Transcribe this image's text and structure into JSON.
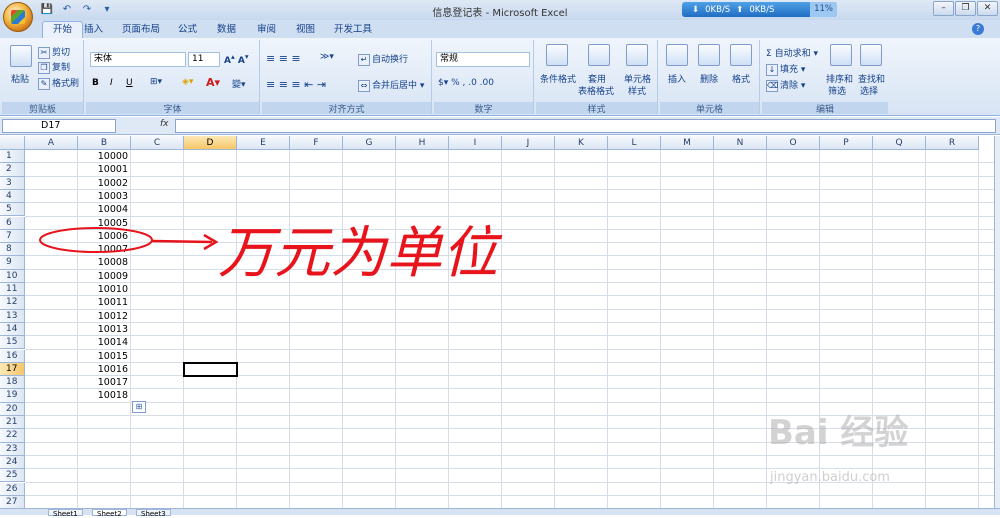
{
  "window": {
    "title": "信息登记表 - Microsoft Excel",
    "net_down": "0KB/S",
    "net_up": "0KB/S",
    "cpu": "11%"
  },
  "tabs": [
    "开始",
    "插入",
    "页面布局",
    "公式",
    "数据",
    "审阅",
    "视图",
    "开发工具"
  ],
  "ribbon": {
    "clipboard": {
      "paste": "粘贴",
      "cut": "剪切",
      "copy": "复制",
      "format_painter": "格式刷",
      "label": "剪贴板"
    },
    "font": {
      "name": "宋体",
      "size": "11",
      "bold": "B",
      "italic": "I",
      "underline": "U",
      "label": "字体"
    },
    "align": {
      "wrap": "自动换行",
      "merge": "合并后居中",
      "label": "对齐方式"
    },
    "number": {
      "format": "常规",
      "label": "数字"
    },
    "styles": {
      "cond": "条件格式",
      "table1": "套用",
      "table2": "表格格式",
      "cell1": "单元格",
      "cell2": "样式",
      "label": "样式"
    },
    "cells": {
      "insert": "插入",
      "delete": "删除",
      "format": "格式",
      "label": "单元格"
    },
    "edit": {
      "autosum": "自动求和",
      "fill": "填充",
      "clear": "清除",
      "sort1": "排序和",
      "sort2": "筛选",
      "find1": "查找和",
      "find2": "选择",
      "label": "编辑"
    }
  },
  "formula_bar": {
    "name_box": "D17",
    "fx": "fx",
    "content": ""
  },
  "columns": [
    "A",
    "B",
    "C",
    "D",
    "E",
    "F",
    "G",
    "H",
    "I",
    "J",
    "K",
    "L",
    "M",
    "N",
    "O",
    "P",
    "Q",
    "R"
  ],
  "rows": [
    "1",
    "2",
    "3",
    "4",
    "5",
    "6",
    "7",
    "8",
    "9",
    "10",
    "11",
    "12",
    "13",
    "14",
    "15",
    "16",
    "17",
    "18",
    "19",
    "20",
    "21",
    "22",
    "23",
    "24",
    "25",
    "26",
    "27"
  ],
  "b_values": [
    "10000",
    "10001",
    "10002",
    "10003",
    "10004",
    "10005",
    "10006",
    "10007",
    "10008",
    "10009",
    "10010",
    "10011",
    "10012",
    "10013",
    "10014",
    "10015",
    "10016",
    "10017",
    "10018"
  ],
  "annotation": "万元为单位",
  "sheets": [
    "Sheet1",
    "Sheet2",
    "Sheet3"
  ],
  "watermark": {
    "brand": "Bai 经验",
    "url": "jingyan.baidu.com"
  },
  "colors": {
    "accent": "#15428b",
    "selected_header": "#f6c667",
    "annotation": "#e8141c"
  }
}
